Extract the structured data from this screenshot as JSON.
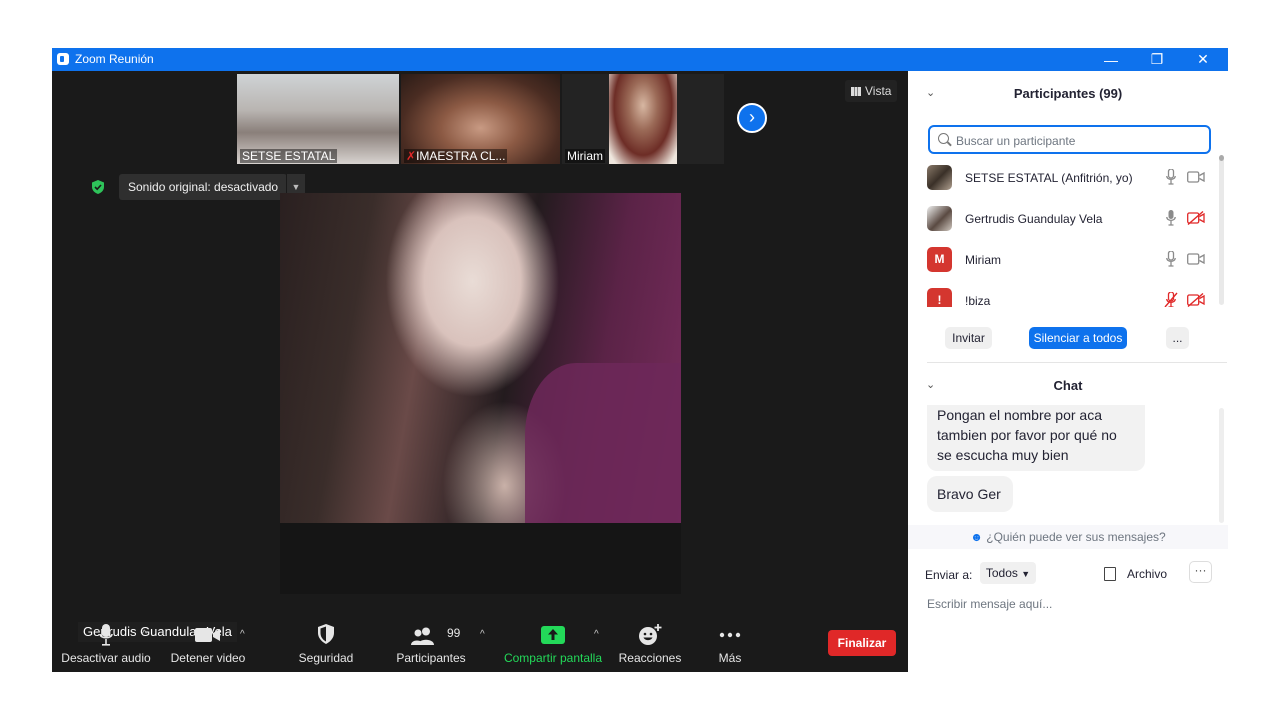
{
  "window": {
    "title": "Zoom Reunión"
  },
  "thumbnails": [
    {
      "label": "SETSE ESTATAL"
    },
    {
      "label": "IMAESTRA CL..."
    },
    {
      "label": "Miriam"
    }
  ],
  "view_button": {
    "label": "Vista"
  },
  "audio_option": {
    "label": "Sonido original: desactivado"
  },
  "active_speaker": {
    "name": "Gertrudis Guandulay Vela"
  },
  "toolbar": {
    "mute_label": "Desactivar audio",
    "video_label": "Detener video",
    "security_label": "Seguridad",
    "participants_label": "Participantes",
    "participants_count": "99",
    "share_label": "Compartir pantalla",
    "reactions_label": "Reacciones",
    "more_label": "Más",
    "end_label": "Finalizar"
  },
  "participants_panel": {
    "title": "Participantes (99)",
    "search_placeholder": "Buscar un participante",
    "participants": [
      {
        "name": "SETSE ESTATAL (Anfitrión, yo)",
        "initial": "",
        "mic_muted": false,
        "video_off": false
      },
      {
        "name": "Gertrudis Guandulay Vela",
        "initial": "",
        "mic_muted": false,
        "video_off": true
      },
      {
        "name": "Miriam",
        "initial": "M",
        "mic_muted": false,
        "video_off": false
      },
      {
        "name": "!biza",
        "initial": "!",
        "mic_muted": true,
        "video_off": true
      }
    ],
    "invite_label": "Invitar",
    "mute_all_label": "Silenciar a todos",
    "more_label": "..."
  },
  "chat_panel": {
    "title": "Chat",
    "messages": [
      {
        "line1": "Pongan el nombre por aca",
        "line2": "tambien por favor por qué no",
        "line3": "se escucha muy bien"
      },
      {
        "text": "Bravo Ger"
      }
    ],
    "who_can_see": "¿Quién puede ver sus mensajes?",
    "send_to_label": "Enviar a:",
    "send_to_value": "Todos",
    "file_label": "Archivo",
    "more_label": "···",
    "input_placeholder": "Escribir mensaje aquí..."
  },
  "colors": {
    "accent": "#0e72ed",
    "end_button": "#e02828",
    "share_green": "#23d959",
    "muted_red": "#e02828"
  }
}
